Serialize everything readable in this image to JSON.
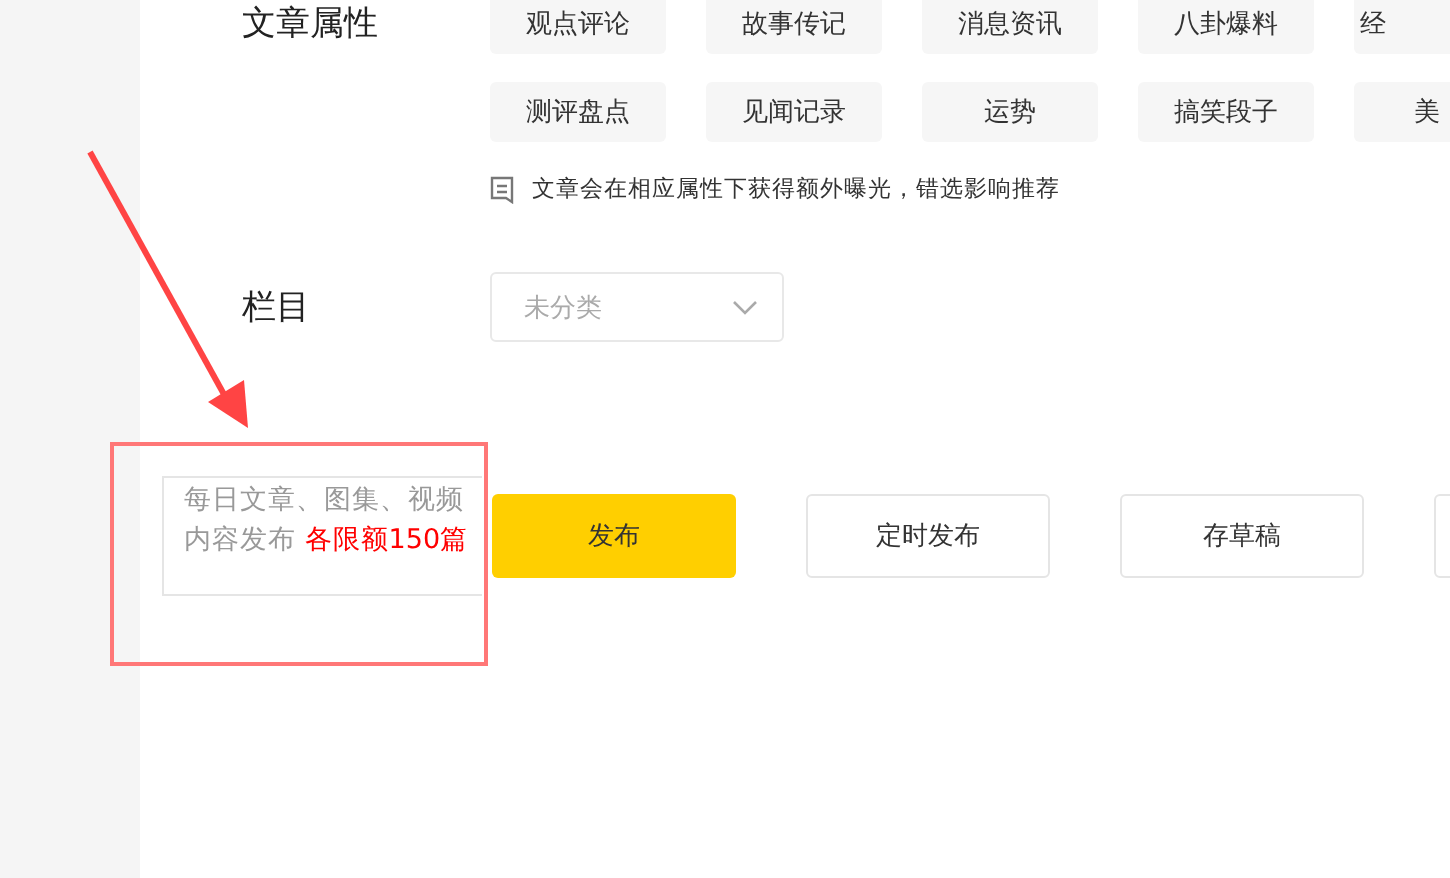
{
  "attributes": {
    "label": "文章属性",
    "tags": [
      {
        "label": "观点评论",
        "selected": false
      },
      {
        "label": "故事传记",
        "selected": false
      },
      {
        "label": "消息资讯",
        "selected": false
      },
      {
        "label": "八卦爆料",
        "selected": false
      },
      {
        "label": "经",
        "selected": false
      },
      {
        "label": "测评盘点",
        "selected": false
      },
      {
        "label": "见闻记录",
        "selected": false
      },
      {
        "label": "运势",
        "selected": false
      },
      {
        "label": "搞笑段子",
        "selected": false
      },
      {
        "label": "美",
        "selected": false
      }
    ],
    "hint": "文章会在相应属性下获得额外曝光，错选影响推荐"
  },
  "column": {
    "label": "栏目",
    "placeholder": "未分类"
  },
  "quota": {
    "text": "每日文章、图集、视频内容发布",
    "highlight": "各限额150篇"
  },
  "buttons": [
    {
      "label": "发布",
      "kind": "primary"
    },
    {
      "label": "定时发布",
      "kind": "normal"
    },
    {
      "label": "存草稿",
      "kind": "normal"
    },
    {
      "kind": "normal"
    }
  ]
}
